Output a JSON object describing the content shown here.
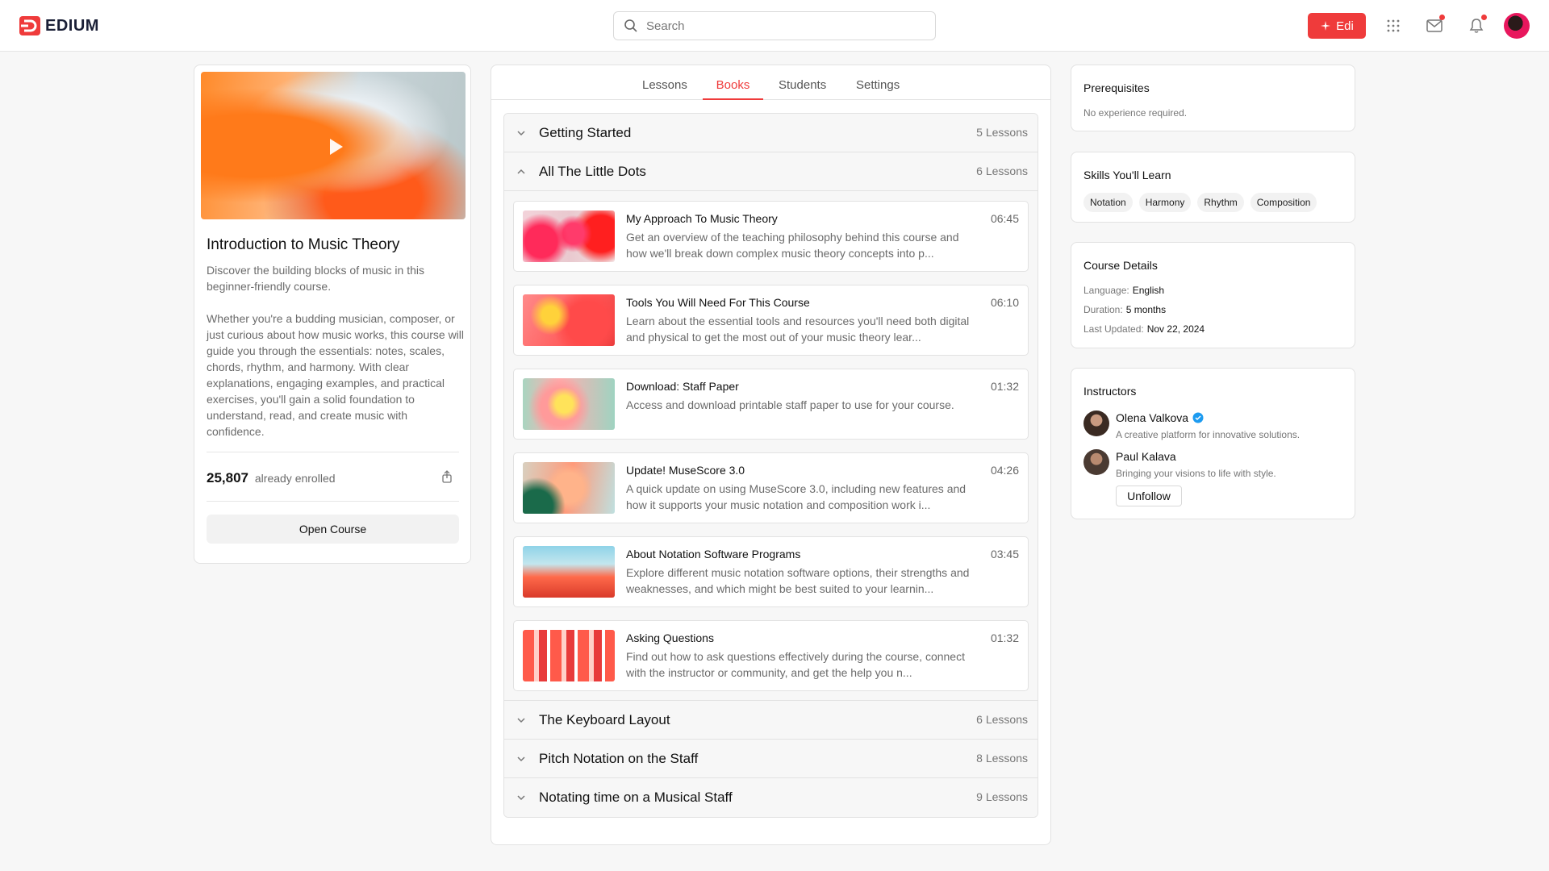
{
  "brand": {
    "name": "EDIUM",
    "accent": "#ef3b3b"
  },
  "header": {
    "search_placeholder": "Search",
    "edit_label": "Edi",
    "icons": [
      "apps-grid-icon",
      "mail-icon",
      "bell-icon"
    ]
  },
  "course": {
    "title": "Introduction to Music Theory",
    "summary": "Discover the building blocks of music in this beginner-friendly course.",
    "description": "Whether you're a budding musician, composer, or just curious about how music works, this course will guide you through the essentials: notes, scales, chords, rhythm, and harmony. With clear explanations, engaging examples, and practical exercises, you'll gain a solid foundation to understand, read, and create music with confidence.",
    "enrolled_count": "25,807",
    "enrolled_label": "already enrolled",
    "open_label": "Open Course"
  },
  "tabs": [
    {
      "label": "Lessons",
      "active": false
    },
    {
      "label": "Books",
      "active": true
    },
    {
      "label": "Students",
      "active": false
    },
    {
      "label": "Settings",
      "active": false
    }
  ],
  "sections": [
    {
      "title": "Getting Started",
      "count": "5 Lessons",
      "expanded": false
    },
    {
      "title": "All The Little Dots",
      "count": "6 Lessons",
      "expanded": true
    },
    {
      "title": "The Keyboard Layout",
      "count": "6 Lessons",
      "expanded": false
    },
    {
      "title": "Pitch Notation on the Staff",
      "count": "8 Lessons",
      "expanded": false
    },
    {
      "title": "Notating time on a Musical Staff",
      "count": "9 Lessons",
      "expanded": false
    }
  ],
  "lessons": [
    {
      "title": "My Approach To Music Theory",
      "time": "06:45",
      "desc": "Get an overview of the teaching philosophy behind this course and how we'll break down complex music theory concepts into p..."
    },
    {
      "title": "Tools You Will Need For This Course",
      "time": "06:10",
      "desc": "Learn about the essential tools and resources you'll need both digital and physical to get the most out of your music theory lear..."
    },
    {
      "title": "Download: Staff Paper",
      "time": "01:32",
      "desc": "Access and download printable staff paper to use for your course."
    },
    {
      "title": "Update! MuseScore 3.0",
      "time": "04:26",
      "desc": "A quick update on using MuseScore 3.0, including new features and how it supports your music notation and composition work i..."
    },
    {
      "title": "About Notation Software Programs",
      "time": "03:45",
      "desc": "Explore different music notation software options, their strengths and weaknesses, and which might be best suited to your learnin..."
    },
    {
      "title": "Asking Questions",
      "time": "01:32",
      "desc": "Find out how to ask questions effectively during the course, connect with the instructor or community, and get the help you n..."
    }
  ],
  "prerequisites": {
    "title": "Prerequisites",
    "text": "No experience required."
  },
  "skills": {
    "title": "Skills You'll Learn",
    "items": [
      "Notation",
      "Harmony",
      "Rhythm",
      "Composition"
    ]
  },
  "details": {
    "title": "Course Details",
    "language_label": "Language:",
    "language": "English",
    "duration_label": "Duration:",
    "duration": "5 months",
    "updated_label": "Last Updated:",
    "updated": "Nov 22, 2024"
  },
  "instructors": {
    "title": "Instructors",
    "items": [
      {
        "name": "Olena Valkova",
        "bio": "A creative platform for innovative solutions.",
        "verified": true
      },
      {
        "name": "Paul Kalava",
        "bio": "Bringing your visions to life with style.",
        "verified": false
      }
    ],
    "unfollow_label": "Unfollow"
  }
}
